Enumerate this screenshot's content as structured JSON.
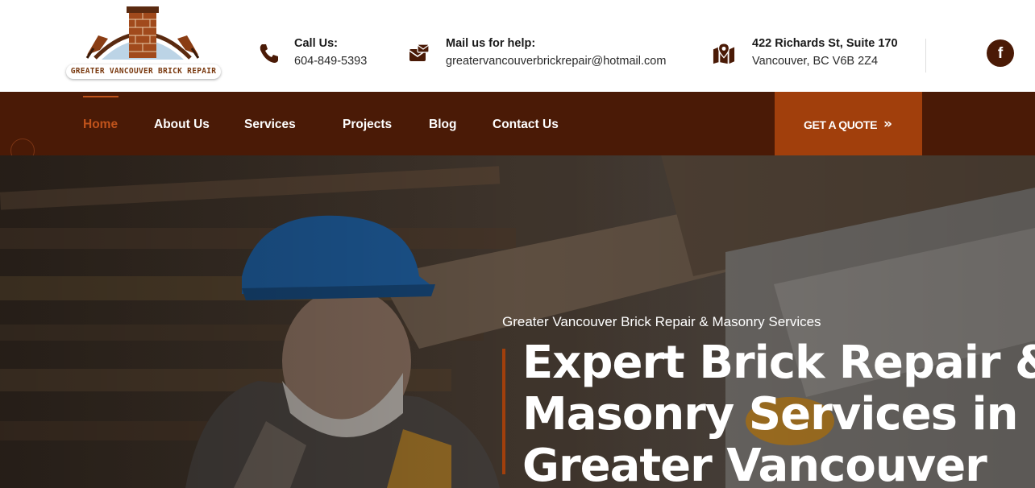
{
  "brand": {
    "logo_text": "GREATER VANCOUVER BRICK REPAIR",
    "icon": "chimney-trowel-logo"
  },
  "contacts": {
    "call": {
      "title": "Call Us:",
      "value": "604-849-5393",
      "icon": "phone-icon"
    },
    "mail": {
      "title": "Mail us for help:",
      "value": "greatervancouverbrickrepair@hotmail.com",
      "icon": "mail-icon"
    },
    "address": {
      "title": "422 Richards St, Suite 170",
      "value": "Vancouver, BC V6B 2Z4",
      "icon": "map-icon"
    }
  },
  "social": {
    "facebook_label": "f",
    "icon": "facebook-icon"
  },
  "nav": {
    "items": [
      {
        "label": "Home",
        "active": true
      },
      {
        "label": "About Us"
      },
      {
        "label": "Services"
      },
      {
        "label": "Projects"
      },
      {
        "label": "Blog"
      },
      {
        "label": "Contact Us"
      }
    ],
    "cta_label": "GET A QUOTE",
    "cta_arrow": "»"
  },
  "hero": {
    "subtitle": "Greater Vancouver Brick Repair & Masonry Services",
    "title_lines": [
      "Expert Brick Repair &",
      "Masonry Services in",
      "Greater Vancouver"
    ]
  },
  "colors": {
    "nav_bg": "#4a1a06",
    "accent": "#a13f0c",
    "active_link": "#c0531b"
  }
}
